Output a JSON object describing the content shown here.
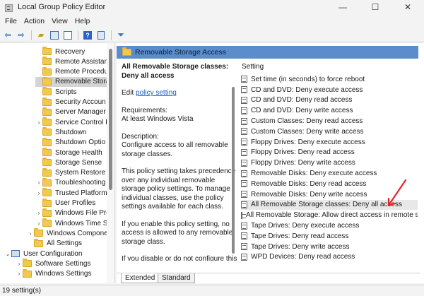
{
  "window": {
    "title": "Local Group Policy Editor",
    "minimize": "—",
    "maximize": "☐",
    "close": "✕"
  },
  "menu": [
    "File",
    "Action",
    "View",
    "Help"
  ],
  "tree": {
    "items": [
      {
        "label": "Recovery",
        "icon": "folder-icon"
      },
      {
        "label": "Remote Assistan",
        "icon": "folder-icon"
      },
      {
        "label": "Remote Procedu",
        "icon": "folder-icon"
      },
      {
        "label": "Removable Stora",
        "icon": "folder-icon",
        "selected": true
      },
      {
        "label": "Scripts",
        "icon": "folder-icon"
      },
      {
        "label": "Security Accoun",
        "icon": "folder-icon"
      },
      {
        "label": "Server Manager",
        "icon": "folder-icon"
      },
      {
        "label": "Service Control I",
        "icon": "folder-icon",
        "expander": "›"
      },
      {
        "label": "Shutdown",
        "icon": "folder-icon"
      },
      {
        "label": "Shutdown Optio",
        "icon": "folder-icon"
      },
      {
        "label": "Storage Health",
        "icon": "folder-icon"
      },
      {
        "label": "Storage Sense",
        "icon": "folder-icon"
      },
      {
        "label": "System Restore",
        "icon": "folder-icon"
      },
      {
        "label": "Troubleshooting",
        "icon": "folder-icon",
        "expander": "›"
      },
      {
        "label": "Trusted Platform",
        "icon": "folder-icon",
        "expander": "›"
      },
      {
        "label": "User Profiles",
        "icon": "folder-icon"
      },
      {
        "label": "Windows File Pro",
        "icon": "folder-icon",
        "expander": "›"
      },
      {
        "label": "Windows Time S",
        "icon": "folder-icon",
        "expander": "›"
      },
      {
        "label": "Windows Compone",
        "icon": "folder-icon",
        "expander": "›"
      },
      {
        "label": "All Settings",
        "icon": "folder-icon"
      },
      {
        "label": "User Configuration",
        "icon": "user-config-icon",
        "expander": "⌄"
      },
      {
        "label": "Software Settings",
        "icon": "folder-icon",
        "expander": "›"
      },
      {
        "label": "Windows Settings",
        "icon": "folder-icon",
        "expander": "›"
      }
    ]
  },
  "header": {
    "title": "Removable Storage Access"
  },
  "description": {
    "policy_title": "All Removable Storage classes: Deny all access",
    "edit_prefix": "Edit",
    "edit_link": "policy setting",
    "requirements_label": "Requirements:",
    "requirements_value": "At least Windows Vista",
    "description_label": "Description:",
    "p1": "Configure access to all removable storage classes.",
    "p2": "This policy setting takes precedence over any individual removable storage policy settings. To manage individual classes, use the policy settings available for each class.",
    "p3": "If you enable this policy setting, no access is allowed to any removable storage class.",
    "p4": "If you disable or do not configure this policy setting, write and read"
  },
  "settings": {
    "column_header": "Setting",
    "rows": [
      "Set time (in seconds) to force reboot",
      "CD and DVD: Deny execute access",
      "CD and DVD: Deny read access",
      "CD and DVD: Deny write access",
      "Custom Classes: Deny read access",
      "Custom Classes: Deny write access",
      "Floppy Drives: Deny execute access",
      "Floppy Drives: Deny read access",
      "Floppy Drives: Deny write access",
      "Removable Disks: Deny execute access",
      "Removable Disks: Deny read access",
      "Removable Disks: Deny write access",
      "All Removable Storage classes: Deny all access",
      "All Removable Storage: Allow direct access in remote s",
      "Tape Drives: Deny execute access",
      "Tape Drives: Deny read access",
      "Tape Drives: Deny write access",
      "WPD Devices: Deny read access"
    ],
    "selected_index": 12
  },
  "tabs": [
    "Extended",
    "Standard"
  ],
  "status": {
    "text": "19 setting(s)"
  },
  "colors": {
    "header_band": "#5b8ccb",
    "annotation_arrow": "#e0242a",
    "link": "#1f5fbf"
  }
}
